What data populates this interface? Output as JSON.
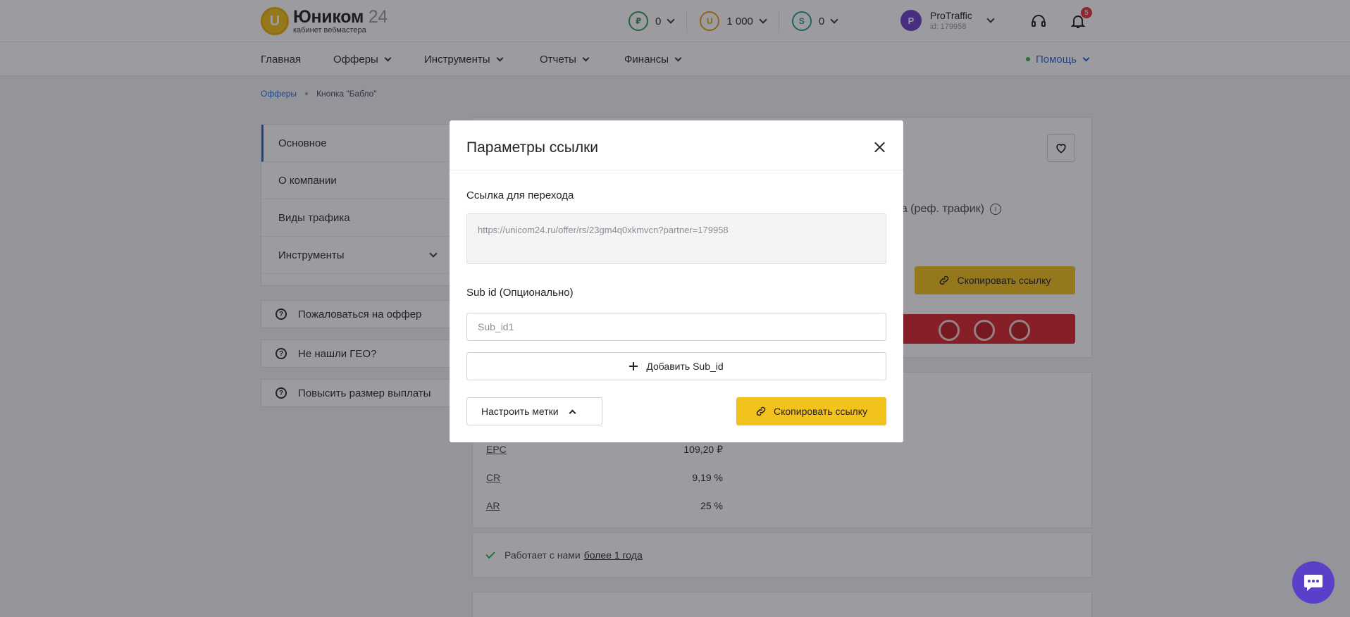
{
  "header": {
    "logo_title": "Юником",
    "logo_num": "24",
    "logo_subtitle": "кабинет вебмастера",
    "balances": [
      {
        "symbol": "₽",
        "value": "0",
        "color": "#3b9b55"
      },
      {
        "symbol": "U",
        "value": "1 000",
        "color": "#e2a21a"
      },
      {
        "symbol": "S",
        "value": "0",
        "color": "#2a9d8f"
      }
    ],
    "profile": {
      "initial": "P",
      "name": "ProTraffic",
      "id": "id: 179958"
    },
    "notifications_count": "5"
  },
  "nav": {
    "items": [
      "Главная",
      "Офферы",
      "Инструменты",
      "Отчеты",
      "Финансы"
    ],
    "help": "Помощь"
  },
  "breadcrumb": {
    "link": "Офферы",
    "current": "Кнопка \"Бабло\""
  },
  "side_menu": {
    "items": [
      "Основное",
      "О компании",
      "Виды трафика",
      "Инструменты"
    ]
  },
  "side_actions": [
    "Пожаловаться на оффер",
    "Не нашли ГЕО?",
    "Повысить размер выплаты"
  ],
  "offer_card": {
    "partial_text": "ача (реф. трафик)",
    "copy_label": "Скопировать ссылку"
  },
  "stats": [
    {
      "label": "EPC",
      "value": "109,20 ₽"
    },
    {
      "label": "CR",
      "value": "9,19 %"
    },
    {
      "label": "AR",
      "value": "25 %"
    }
  ],
  "works_with": {
    "text": "Работает с нами",
    "link": "более 1 года"
  },
  "modal": {
    "title": "Параметры ссылки",
    "link_label": "Ссылка для перехода",
    "link_value": "https://unicom24.ru/offer/rs/23gm4q0xkmvcn?partner=179958",
    "subid_label": "Sub id (Опционально)",
    "subid_placeholder": "Sub_id1",
    "add_subid": "Добавить Sub_id",
    "tags_button": "Настроить метки",
    "copy_button": "Скопировать ссылку"
  },
  "colors": {
    "accent": "#f4c21c",
    "link": "#2a6fd6",
    "chat": "#5a3fc9"
  }
}
